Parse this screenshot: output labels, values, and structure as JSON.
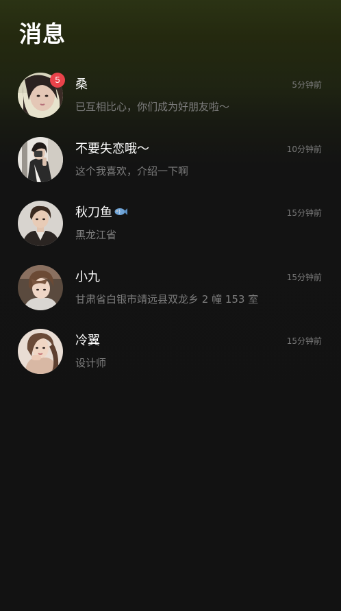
{
  "header": {
    "title": "消息"
  },
  "conversations": [
    {
      "name": "桑",
      "time": "5分钟前",
      "preview": "已互相比心，你们成为好朋友啦～",
      "unread": "5",
      "avatar": "avatar-photo-girl-long-hair"
    },
    {
      "name": "不要失恋哦～",
      "time": "10分钟前",
      "preview": "这个我喜欢，介绍一下啊",
      "avatar": "avatar-photo-mirror-selfie"
    },
    {
      "name": "秋刀鱼",
      "name_icon": "fish-icon",
      "time": "15分钟前",
      "preview": "黑龙江省",
      "avatar": "avatar-photo-boy-jacket"
    },
    {
      "name": "小九",
      "time": "15分钟前",
      "preview": "甘肃省白银市靖远县双龙乡 2 幢 153 室",
      "avatar": "avatar-photo-boy-brown-hair"
    },
    {
      "name": "冷翼",
      "time": "15分钟前",
      "preview": "设计师",
      "avatar": "avatar-photo-girl-hand-face"
    }
  ],
  "colors": {
    "background": "#121212",
    "header_gradient_top": "#2b3314",
    "badge": "#e9434a",
    "secondary_text": "#7d7d7d"
  }
}
